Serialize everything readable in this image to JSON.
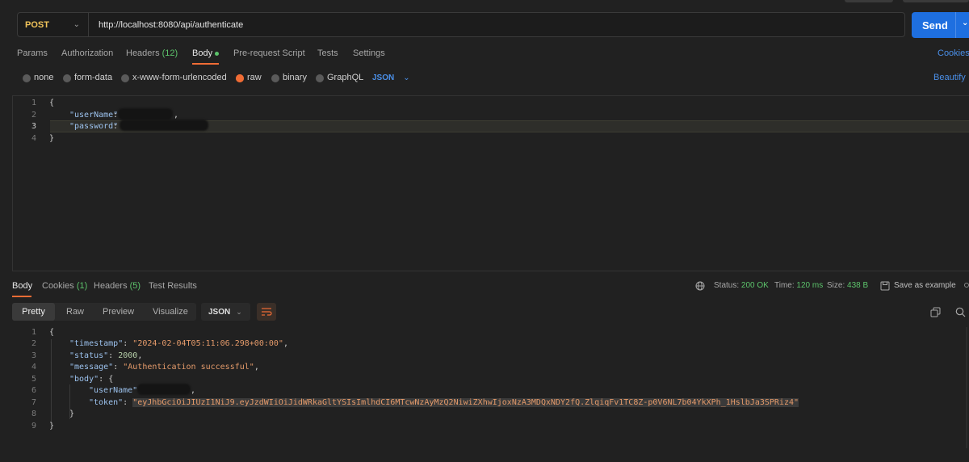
{
  "request": {
    "method": "POST",
    "url": "http://localhost:8080/api/authenticate",
    "send_label": "Send"
  },
  "tabs": [
    {
      "label": "Params"
    },
    {
      "label": "Authorization"
    },
    {
      "label": "Headers",
      "count": "(12)"
    },
    {
      "label": "Body"
    },
    {
      "label": "Pre-request Script"
    },
    {
      "label": "Tests"
    },
    {
      "label": "Settings"
    }
  ],
  "cookies_link": "Cookies",
  "body_types": {
    "options": [
      "none",
      "form-data",
      "x-www-form-urlencoded",
      "raw",
      "binary",
      "GraphQL"
    ],
    "selected": "raw",
    "format": "JSON",
    "beautify_label": "Beautify"
  },
  "request_body": {
    "line_numbers": [
      "1",
      "2",
      "3",
      "4"
    ],
    "open_brace": "{",
    "close_brace": "}",
    "username_key": "\"userName\"",
    "password_key": "\"password\"",
    "comma": ",",
    "colon": ":"
  },
  "response": {
    "tabs": [
      {
        "label": "Body"
      },
      {
        "label": "Cookies",
        "count": "(1)"
      },
      {
        "label": "Headers",
        "count": "(5)"
      },
      {
        "label": "Test Results"
      }
    ],
    "status_label": "Status:",
    "status_value": "200 OK",
    "time_label": "Time:",
    "time_value": "120 ms",
    "size_label": "Size:",
    "size_value": "438 B",
    "save_label": "Save as example",
    "view_modes": [
      "Pretty",
      "Raw",
      "Preview",
      "Visualize"
    ],
    "active_view": "Pretty",
    "format": "JSON",
    "line_numbers": [
      "1",
      "2",
      "3",
      "4",
      "5",
      "6",
      "7",
      "8",
      "9"
    ],
    "timestamp_key": "\"timestamp\"",
    "timestamp_value": "\"2024-02-04T05:11:06.298+00:00\"",
    "status_key": "\"status\"",
    "status_code": "2000",
    "message_key": "\"message\"",
    "message_value": "\"Authentication successful\"",
    "body_key": "\"body\"",
    "username_key": "\"userName\"",
    "token_key": "\"token\"",
    "token_value": "\"eyJhbGciOiJIUzI1NiJ9.eyJzdWIiOiJidWRkaGltYSIsImlhdCI6MTcwNzAyMzQ2NiwiZXhwIjoxNzA3MDQxNDY2fQ.ZlqiqFv1TC8Z-p0V6NL7b04YkXPh_1HslbJa3SPRiz4\""
  },
  "colors": {
    "accent": "#f06c35",
    "send": "#1e6fe0",
    "link": "#4a8fe8",
    "success": "#5cc36b",
    "method": "#f0c35a"
  },
  "icons": [
    "chevron-down-icon",
    "globe-icon",
    "save-icon",
    "wrap-lines-icon",
    "copy-icon",
    "search-icon"
  ]
}
